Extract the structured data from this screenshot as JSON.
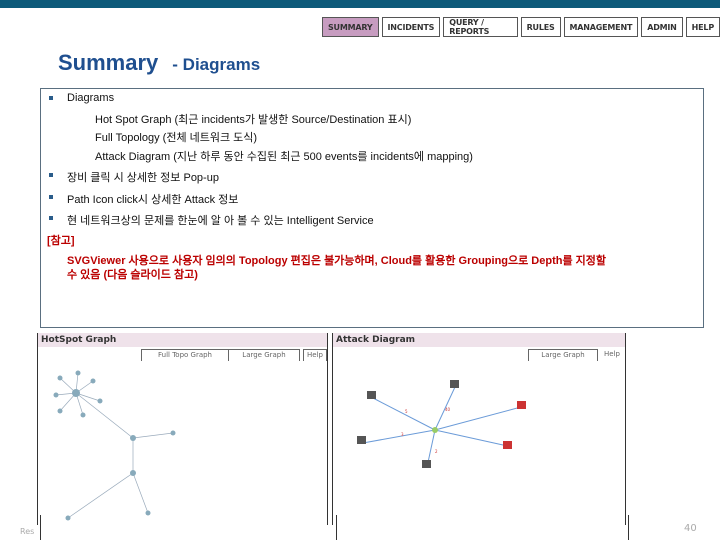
{
  "nav": {
    "tabs": [
      {
        "label": "SUMMARY",
        "active": true
      },
      {
        "label": "INCIDENTS"
      },
      {
        "label": "QUERY / REPORTS"
      },
      {
        "label": "RULES"
      },
      {
        "label": "MANAGEMENT"
      },
      {
        "label": "ADMIN"
      },
      {
        "label": "HELP"
      }
    ]
  },
  "title": {
    "main": "Summary",
    "sub": "- Diagrams"
  },
  "content": {
    "bullets": [
      "Diagrams",
      "장비 클릭 시 상세한 정보 Pop-up",
      "Path Icon click시 상세한 Attack 정보",
      "현 네트워크상의 문제를 한눈에 알 아 볼 수 있는 Intelligent Service"
    ],
    "sub_items": [
      "Hot Spot Graph (최근 incidents가 발생한 Source/Destination 표시)",
      "Full Topology (전체 네트워크 도식)",
      "Attack Diagram (지난 하루 동안 수집된 최근 500 events를 incidents에 mapping)"
    ],
    "note_label": "[참고]",
    "note_line1": "SVGViewer 사용으로 사용자 임의의 Topology 편집은 불가능하며, Cloud를 활용한 Grouping으로 Depth를 지정할",
    "note_line2": "수 있음 (다음 슬라이드 참고)"
  },
  "hotspot": {
    "title": "HotSpot Graph",
    "buttons": [
      "Full Topo Graph",
      "Large Graph",
      "Help"
    ]
  },
  "attack": {
    "title": "Attack Diagram",
    "buttons": [
      "Large Graph",
      "Help"
    ]
  },
  "colors": {
    "accent": "#1f4f8f",
    "note": "#bb0000",
    "topbar": "#0d5a7a",
    "active_tab": "#c79cc0"
  },
  "footer": {
    "left": "Res",
    "page": "40"
  }
}
